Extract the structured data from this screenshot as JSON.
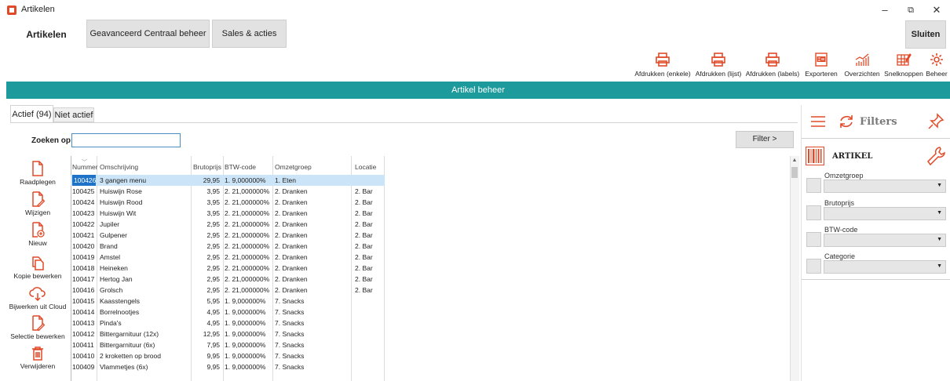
{
  "window": {
    "title": "Artikelen",
    "minimize": "–",
    "maximize": "⧉",
    "close": "✕"
  },
  "nav": {
    "active": "Artikelen",
    "tab1": "Geavanceerd Centraal beheer",
    "tab2": "Sales & acties",
    "close": "Sluiten"
  },
  "toolbar": [
    {
      "label": "Afdrukken (enkele)"
    },
    {
      "label": "Afdrukken (lijst)"
    },
    {
      "label": "Afdrukken (labels)"
    },
    {
      "label": "Exporteren"
    },
    {
      "label": "Overzichten"
    },
    {
      "label": "Snelknoppen"
    },
    {
      "label": "Beheer"
    }
  ],
  "header": {
    "title": "Artikel beheer"
  },
  "tabs": {
    "active": "Actief (94)",
    "inactive": "Niet actief"
  },
  "search": {
    "label": "Zoeken op:",
    "value": ""
  },
  "filter_button": "Filter >",
  "actions": [
    "Raadplegen",
    "Wijzigen",
    "Nieuw",
    "Kopie bewerken",
    "Bijwerken uit Cloud",
    "Selectie bewerken",
    "Verwijderen"
  ],
  "table": {
    "sort_glyph": "﹀",
    "columns": [
      "Nummer",
      "Omschrijving",
      "Brutoprijs",
      "BTW-code",
      "Omzetgroep",
      "Locatie"
    ],
    "rows": [
      [
        "100426",
        "3 gangen menu",
        "29,95",
        "1. 9,000000%",
        "1. Eten",
        ""
      ],
      [
        "100425",
        "Huiswijn Rose",
        "3,95",
        "2. 21,000000%",
        "2. Dranken",
        "2. Bar"
      ],
      [
        "100424",
        "Huiswijn Rood",
        "3,95",
        "2. 21,000000%",
        "2. Dranken",
        "2. Bar"
      ],
      [
        "100423",
        "Huiswijn Wit",
        "3,95",
        "2. 21,000000%",
        "2. Dranken",
        "2. Bar"
      ],
      [
        "100422",
        "Jupiler",
        "2,95",
        "2. 21,000000%",
        "2. Dranken",
        "2. Bar"
      ],
      [
        "100421",
        "Gulpener",
        "2,95",
        "2. 21,000000%",
        "2. Dranken",
        "2. Bar"
      ],
      [
        "100420",
        "Brand",
        "2,95",
        "2. 21,000000%",
        "2. Dranken",
        "2. Bar"
      ],
      [
        "100419",
        "Amstel",
        "2,95",
        "2. 21,000000%",
        "2. Dranken",
        "2. Bar"
      ],
      [
        "100418",
        "Heineken",
        "2,95",
        "2. 21,000000%",
        "2. Dranken",
        "2. Bar"
      ],
      [
        "100417",
        "Hertog Jan",
        "2,95",
        "2. 21,000000%",
        "2. Dranken",
        "2. Bar"
      ],
      [
        "100416",
        "Grolsch",
        "2,95",
        "2. 21,000000%",
        "2. Dranken",
        "2. Bar"
      ],
      [
        "100415",
        "Kaasstengels",
        "5,95",
        "1. 9,000000%",
        "7. Snacks",
        ""
      ],
      [
        "100414",
        "Borrelnootjes",
        "4,95",
        "1. 9,000000%",
        "7. Snacks",
        ""
      ],
      [
        "100413",
        "Pinda's",
        "4,95",
        "1. 9,000000%",
        "7. Snacks",
        ""
      ],
      [
        "100412",
        "Bittergarnituur (12x)",
        "12,95",
        "1. 9,000000%",
        "7. Snacks",
        ""
      ],
      [
        "100411",
        "Bittergarnituur (6x)",
        "7,95",
        "1. 9,000000%",
        "7. Snacks",
        ""
      ],
      [
        "100410",
        "2 kroketten op brood",
        "9,95",
        "1. 9,000000%",
        "7. Snacks",
        ""
      ],
      [
        "100409",
        "Vlammetjes (6x)",
        "9,95",
        "1. 9,000000%",
        "7. Snacks",
        ""
      ]
    ]
  },
  "filter_panel": {
    "title": "Filters",
    "section": "ARTIKEL",
    "fields": [
      "Omzetgroep",
      "Brutoprijs",
      "BTW-code",
      "Categorie"
    ]
  },
  "colors": {
    "accent": "#e14a28",
    "header": "#1d9a9c",
    "selection": "#1e73c9"
  }
}
